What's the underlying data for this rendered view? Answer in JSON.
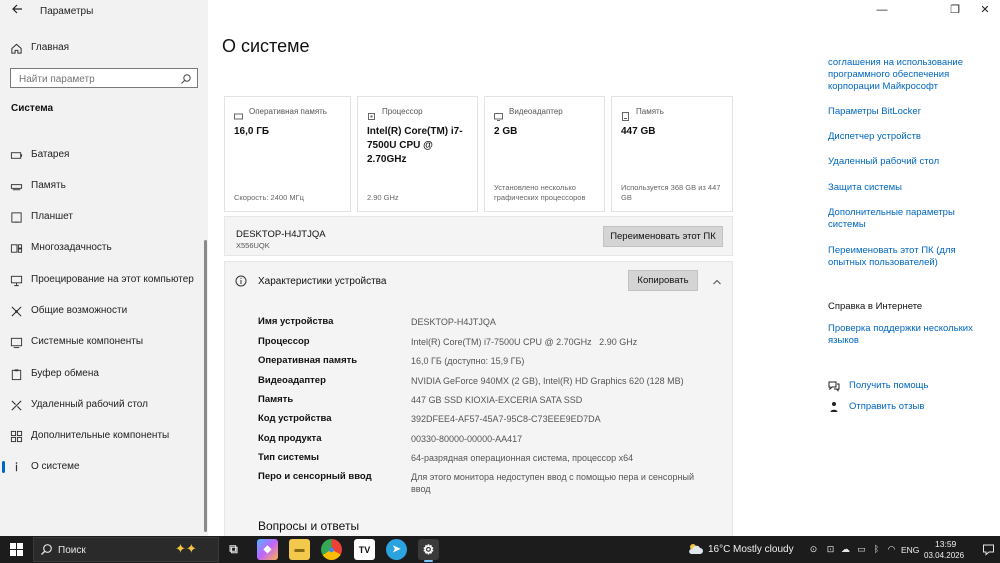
{
  "window": {
    "title": "Параметры",
    "back_icon": "arrow-left-icon",
    "minimize": "—",
    "maximize": "❐",
    "close": "✕"
  },
  "sidebar": {
    "home_label": "Главная",
    "search_placeholder": "Найти параметр",
    "section_title": "Система",
    "items": [
      {
        "label": "Батарея",
        "icon": "battery-icon"
      },
      {
        "label": "Память",
        "icon": "storage-icon"
      },
      {
        "label": "Планшет",
        "icon": "tablet-icon"
      },
      {
        "label": "Многозадачность",
        "icon": "multitasking-icon"
      },
      {
        "label": "Проецирование на этот компьютер",
        "icon": "projecting-icon"
      },
      {
        "label": "Общие возможности",
        "icon": "shared-experiences-icon"
      },
      {
        "label": "Системные компоненты",
        "icon": "system-components-icon"
      },
      {
        "label": "Буфер обмена",
        "icon": "clipboard-icon"
      },
      {
        "label": "Удаленный рабочий стол",
        "icon": "remote-desktop-icon"
      },
      {
        "label": "Дополнительные компоненты",
        "icon": "optional-features-icon"
      },
      {
        "label": "О системе",
        "icon": "info-icon",
        "active": true
      }
    ]
  },
  "main": {
    "title": "О системе",
    "cards": [
      {
        "title": "Оперативная память",
        "value": "16,0 ГБ",
        "foot": "Скорость: 2400 МГц",
        "icon": "ram-icon"
      },
      {
        "title": "Процессор",
        "value": "Intel(R) Core(TM) i7-7500U CPU @ 2.70GHz",
        "foot": "2.90 GHz",
        "icon": "cpu-icon"
      },
      {
        "title": "Видеоадаптер",
        "value": "2 GB",
        "foot": "Установлено несколько графических процессоров",
        "icon": "gpu-icon"
      },
      {
        "title": "Память",
        "value": "447 GB",
        "foot": "Используется 368 GB из 447 GB",
        "icon": "disk-icon"
      }
    ],
    "pc": {
      "name": "DESKTOP-H4JTJQA",
      "model": "X556UQK",
      "rename_label": "Переименовать этот ПК"
    },
    "specs": {
      "title": "Характеристики устройства",
      "copy_label": "Копировать",
      "rows": [
        {
          "label": "Имя устройства",
          "value": "DESKTOP-H4JTJQA"
        },
        {
          "label": "Процессор",
          "value": "Intel(R) Core(TM) i7-7500U CPU @ 2.70GHz   2.90 GHz"
        },
        {
          "label": "Оперативная память",
          "value": "16,0 ГБ (доступно: 15,9 ГБ)"
        },
        {
          "label": "Видеоадаптер",
          "value": "NVIDIA GeForce 940MX (2 GB), Intel(R) HD Graphics 620 (128 MB)"
        },
        {
          "label": "Память",
          "value": "447 GB SSD KIOXIA-EXCERIA SATA SSD"
        },
        {
          "label": "Код устройства",
          "value": "392DFEE4-AF57-45A7-95C8-C73EEE9ED7DA"
        },
        {
          "label": "Код продукта",
          "value": "00330-80000-00000-AA417"
        },
        {
          "label": "Тип системы",
          "value": "64-разрядная операционная система, процессор x64"
        },
        {
          "label": "Перо и сенсорный ввод",
          "value": "Для этого монитора недоступен ввод с помощью пера и сенсорный ввод"
        }
      ]
    },
    "qa_title": "Вопросы и ответы"
  },
  "right": {
    "links": [
      "соглашения на использование программного обеспечения корпорации Майкрософт",
      "Параметры BitLocker",
      "Диспетчер устройств",
      "Удаленный рабочий стол",
      "Защита системы",
      "Дополнительные параметры системы",
      "Переименовать этот ПК (для опытных пользователей)"
    ],
    "help_heading": "Справка в Интернете",
    "help_link": "Проверка поддержки нескольких языков",
    "get_help": "Получить помощь",
    "feedback": "Отправить отзыв"
  },
  "taskbar": {
    "search_label": "Поиск",
    "apps": [
      {
        "name": "task-view",
        "glyph": "⧉"
      },
      {
        "name": "copilot",
        "glyph": "◆"
      },
      {
        "name": "file-explorer",
        "glyph": "▬"
      },
      {
        "name": "chrome",
        "glyph": "●"
      },
      {
        "name": "tradingview",
        "glyph": "TV"
      },
      {
        "name": "telegram",
        "glyph": "➤"
      },
      {
        "name": "settings",
        "glyph": "⚙"
      }
    ],
    "temperature": "16°C",
    "weather": "Mostly cloudy",
    "language": "ENG",
    "time": "13:59",
    "date": "03.04.2026"
  }
}
